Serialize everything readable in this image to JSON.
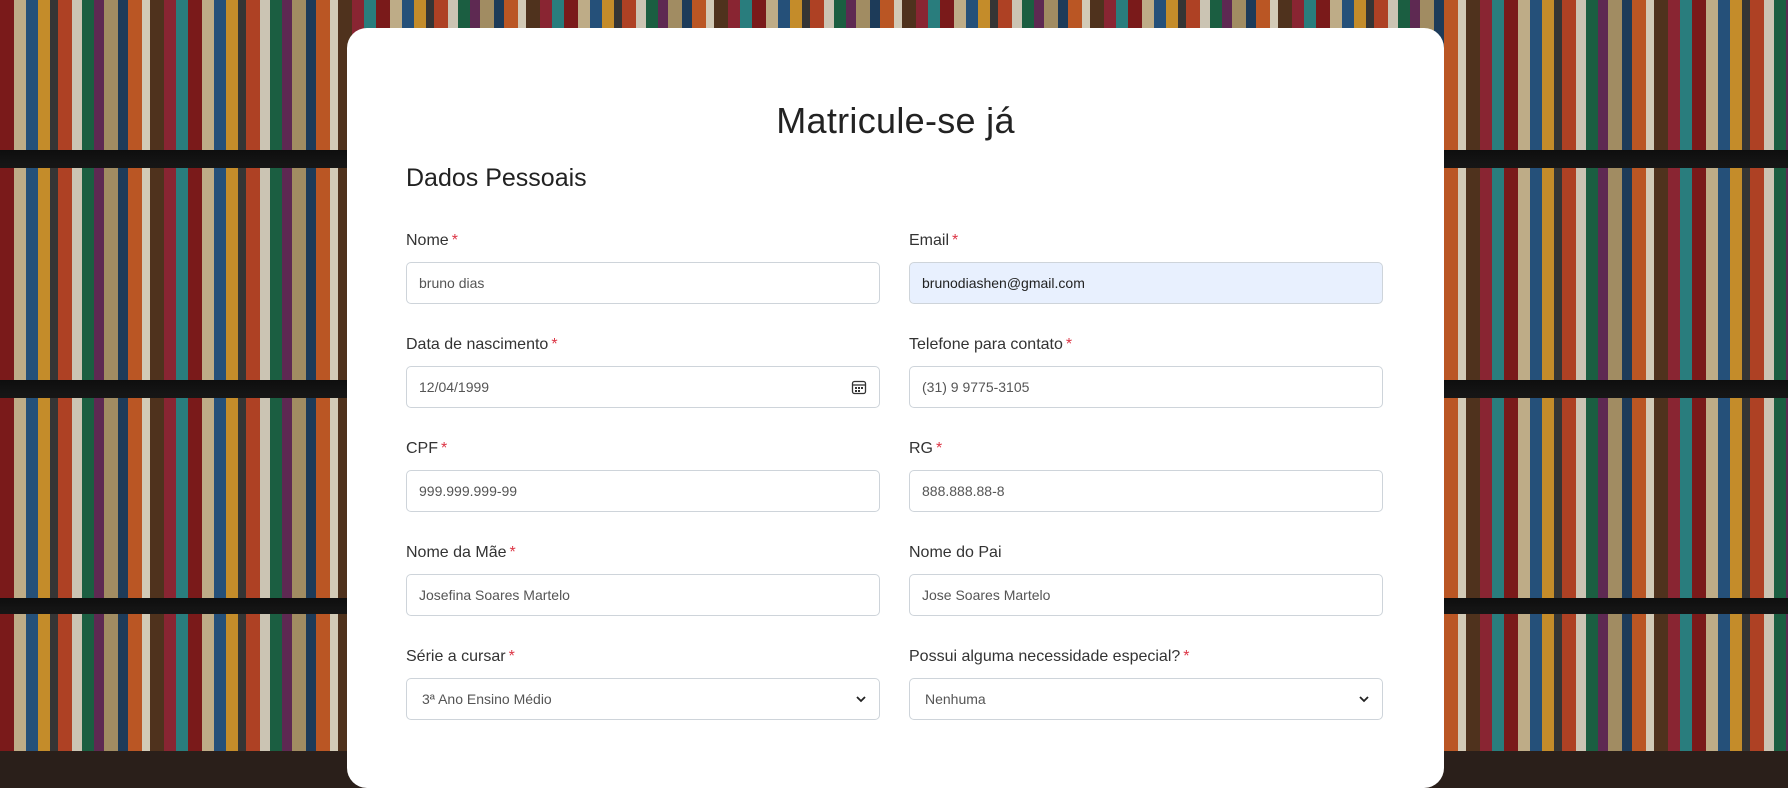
{
  "page": {
    "title": "Matricule-se já",
    "section": "Dados Pessoais"
  },
  "fields": {
    "nome": {
      "label": "Nome",
      "value": "bruno dias",
      "required": "*"
    },
    "email": {
      "label": "Email",
      "value": "brunodiashen@gmail.com",
      "required": "*"
    },
    "nascimento": {
      "label": "Data de nascimento",
      "value": "12/04/1999",
      "required": "*"
    },
    "telefone": {
      "label": "Telefone para contato",
      "value": "(31) 9 9775-3105",
      "required": "*"
    },
    "cpf": {
      "label": "CPF",
      "value": "999.999.999-99",
      "required": "*"
    },
    "rg": {
      "label": "RG",
      "value": "888.888.88-8",
      "required": "*"
    },
    "mae": {
      "label": "Nome da Mãe",
      "value": "Josefina Soares Martelo",
      "required": "*"
    },
    "pai": {
      "label": "Nome do Pai",
      "value": "Jose Soares Martelo"
    },
    "serie": {
      "label": "Série a cursar",
      "value": "3ª Ano Ensino Médio",
      "required": "*"
    },
    "necessidade": {
      "label": "Possui alguma necessidade especial?",
      "value": "Nenhuma",
      "required": "*"
    }
  },
  "icons": {
    "date": "calendar-icon",
    "select": "chevron-down-icon"
  },
  "colors": {
    "required": "#dc3545",
    "autofill": "#e8f0fe",
    "border": "#ced4da"
  }
}
